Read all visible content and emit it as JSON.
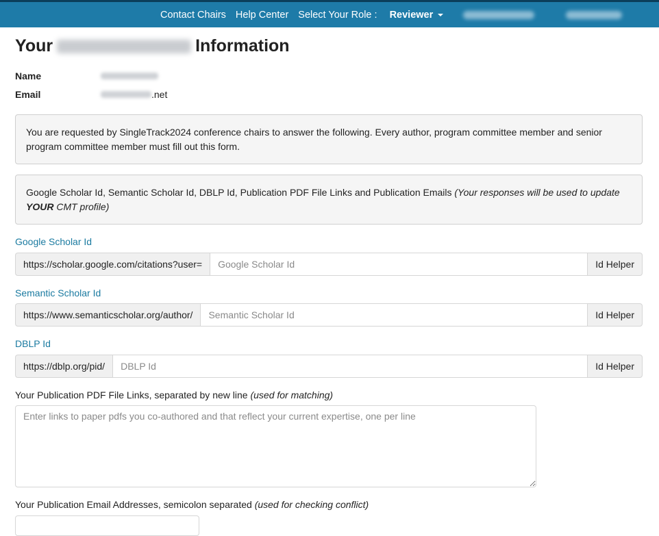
{
  "nav": {
    "contact_chairs": "Contact Chairs",
    "help_center": "Help Center",
    "select_role_label": "Select Your Role :",
    "role": "Reviewer",
    "bar_color": "#1e7ba8"
  },
  "page": {
    "title_prefix": "Your",
    "title_suffix": "Information"
  },
  "user_info": {
    "name_label": "Name",
    "email_label": "Email",
    "email_suffix": ".net"
  },
  "notices": {
    "request": "You are requested by SingleTrack2024 conference chairs to answer the following. Every author, program committee member and senior program committee member must fill out this form.",
    "section_main": "Google Scholar Id, Semantic Scholar Id, DBLP Id, Publication PDF File Links and Publication Emails ",
    "section_note_a": "(Your responses will be used to update ",
    "section_note_bold": "YOUR",
    "section_note_b": " CMT profile)"
  },
  "fields": {
    "google": {
      "label": "Google Scholar Id",
      "prefix": "https://scholar.google.com/citations?user=",
      "placeholder": "Google Scholar Id",
      "helper": "Id Helper"
    },
    "semantic": {
      "label": "Semantic Scholar Id",
      "prefix": "https://www.semanticscholar.org/author/",
      "placeholder": "Semantic Scholar Id",
      "helper": "Id Helper"
    },
    "dblp": {
      "label": "DBLP Id",
      "prefix": "https://dblp.org/pid/",
      "placeholder": "DBLP Id",
      "helper": "Id Helper"
    },
    "pdf_links": {
      "label": "Your Publication PDF File Links, separated by new line ",
      "label_note": "(used for matching)",
      "placeholder": "Enter links to paper pdfs you co-authored and that reflect your current expertise, one per line"
    },
    "emails": {
      "label": "Your Publication Email Addresses, semicolon separated ",
      "label_note": "(used for checking conflict)"
    }
  }
}
